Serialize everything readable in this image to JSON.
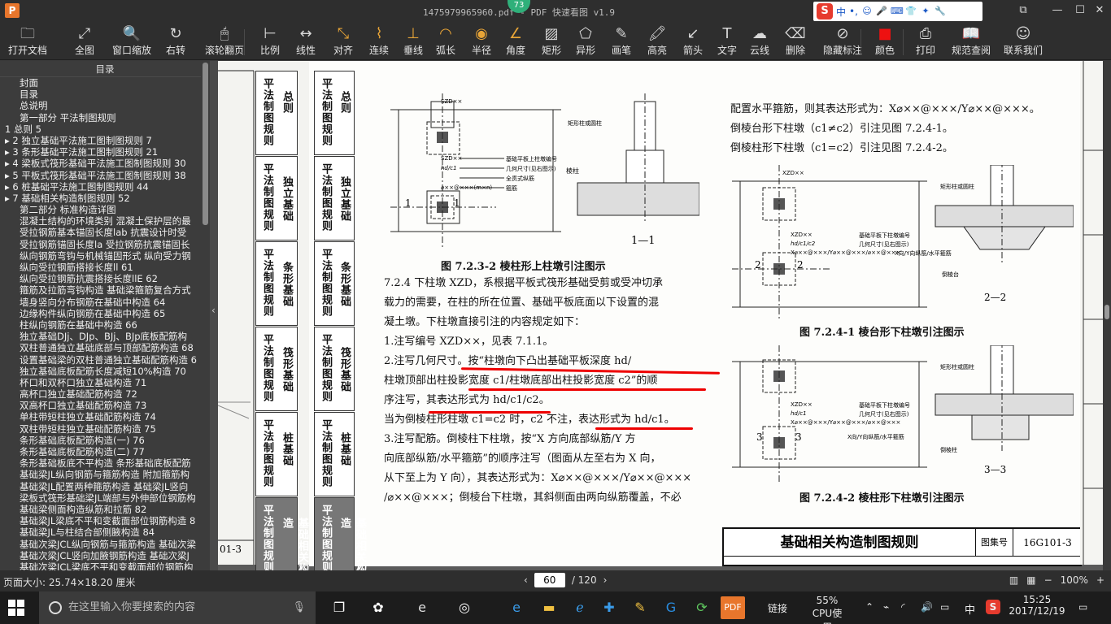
{
  "window": {
    "title": "1475979965960.pdf - PDF 快速看图 v1.9",
    "badge": "73",
    "ime": {
      "mode": "中",
      "punct": "•,"
    }
  },
  "toolbar": {
    "items": [
      {
        "label": "打开文档",
        "icon": "folder-icon"
      },
      {
        "label": "全图",
        "icon": "fit-all-icon"
      },
      {
        "label": "窗口缩放",
        "icon": "magnify-icon"
      },
      {
        "label": "右转",
        "icon": "rotate-right-icon"
      },
      {
        "label": "滚轮翻页",
        "icon": "mouse-icon"
      },
      {
        "label": "比例",
        "icon": "scale-icon"
      },
      {
        "label": "线性",
        "icon": "linear-measure-icon"
      },
      {
        "label": "对齐",
        "icon": "align-measure-icon"
      },
      {
        "label": "连续",
        "icon": "continuous-measure-icon"
      },
      {
        "label": "垂线",
        "icon": "perpendicular-icon"
      },
      {
        "label": "弧长",
        "icon": "arc-length-icon"
      },
      {
        "label": "半径",
        "icon": "radius-icon"
      },
      {
        "label": "角度",
        "icon": "angle-icon"
      },
      {
        "label": "矩形",
        "icon": "rectangle-area-icon"
      },
      {
        "label": "异形",
        "icon": "polygon-area-icon"
      },
      {
        "label": "画笔",
        "icon": "pen-icon"
      },
      {
        "label": "高亮",
        "icon": "highlight-icon"
      },
      {
        "label": "箭头",
        "icon": "arrow-icon"
      },
      {
        "label": "文字",
        "icon": "text-icon"
      },
      {
        "label": "云线",
        "icon": "cloud-line-icon"
      },
      {
        "label": "删除",
        "icon": "eraser-icon"
      },
      {
        "label": "隐藏标注",
        "icon": "hide-markup-icon"
      },
      {
        "label": "颜色",
        "icon": "color-swatch-icon"
      },
      {
        "label": "打印",
        "icon": "printer-icon"
      },
      {
        "label": "规范查阅",
        "icon": "book-icon"
      },
      {
        "label": "联系我们",
        "icon": "contact-icon"
      }
    ]
  },
  "sidebar": {
    "header": "目录",
    "items": [
      "封面",
      "目录",
      "总说明",
      "第一部分  平法制图规则",
      "1 总则  5",
      "▸ 2 独立基础平法施工图制图规则  7",
      "▸ 3 条形基础平法施工图制图规则  21",
      "▸ 4 梁板式筏形基础平法施工图制图规则  30",
      "▸ 5 平板式筏形基础平法施工图制图规则  38",
      "▸ 6 桩基础平法施工图制图规则  44",
      "▸ 7 基础相关构造制图规则  52",
      "第二部分  标准构造详图",
      "混凝土结构的环境类别  混凝土保护层的最",
      "受拉钢筋基本锚固长度lab  抗震设计时受",
      "受拉钢筋锚固长度la  受拉钢筋抗震锚固长",
      "纵向钢筋弯钩与机械锚固形式  纵向受力钢",
      "纵向受拉钢筋搭接长度ll  61",
      "纵向受拉钢筋抗震搭接长度llE  62",
      "箍筋及拉筋弯钩构造  基础梁箍筋复合方式",
      "墙身竖向分布钢筋在基础中构造  64",
      "边缘构件纵向钢筋在基础中构造  65",
      "柱纵向钢筋在基础中构造  66",
      "独立基础DJj、DJp、BJj、BJp底板配筋构",
      "双柱普通独立基础底部与顶部配筋构造  68",
      "设置基础梁的双柱普通独立基础配筋构造  6",
      "独立基础底板配筋长度减短10%构造  70",
      "杯口和双杯口独立基础构造  71",
      "高杯口独立基础配筋构造  72",
      "双高杯口独立基础配筋构造  73",
      "单柱带短柱独立基础配筋构造  74",
      "双柱带短柱独立基础配筋构造  75",
      "条形基础底板配筋构造(一)  76",
      "条形基础底板配筋构造(二)  77",
      "条形基础板底不平构造  条形基础底板配筋",
      "基础梁JL纵向钢筋与箍筋构造  附加箍筋构",
      "基础梁JL配置两种箍筋构造  基础梁JL竖向",
      "梁板式筏形基础梁JL端部与外伸部位钢筋构",
      "基础梁侧面构造纵筋和拉筋  82",
      "基础梁JL梁底不平和变截面部位钢筋构造  8",
      "基础梁JL与柱结合部侧腋构造  84",
      "基础次梁JCL纵向钢筋与箍筋构造  基础次梁",
      "基础次梁JCL竖向加腋钢筋构造  基础次梁J",
      "基础次梁JCL梁底不平和变截面部位钢筋构"
    ]
  },
  "document": {
    "tabs_left": [
      "平法制图规则",
      "总则",
      "平法制图规则",
      "独立基础",
      "平法制图规则",
      "条形基础",
      "平法制图规则",
      "筏形基础",
      "平法制图规则",
      "桩基础",
      "平法制图规则",
      "基础相关构造"
    ],
    "page_code_left": "01-3",
    "tabs_main": [
      "平法制图规则",
      "总则",
      "平法制图规则",
      "独立基础",
      "平法制图规则",
      "条形基础",
      "平法制图规则",
      "筏形基础",
      "平法制图规则",
      "桩基础",
      "平法制图规则",
      "基础相关构造"
    ],
    "fig_7232_caption": "图 7.2.3-2  棱柱形上柱墩引注图示",
    "section_label_11": "1—1",
    "para_724_title": "7.2.4  下柱墩 XZD，",
    "para_724_lines": [
      "7.2.4  下柱墩 XZD，系根据平板式筏形基础受剪或受冲切承",
      "载力的需要，在柱的所在位置、基础平板底面以下设置的混",
      "凝土墩。下柱墩直接引注的内容规定如下：",
      "    1.注写编号 XZD××，见表 7.1.1。",
      "    2.注写几何尺寸。按“柱墩向下凸出基础平板深度  hd/",
      "柱墩顶部出柱投影宽度  c1/柱墩底部出柱投影宽度  c2”的顺",
      "序注写，其表达形式为 hd/c1/c2。",
      "    当为倒棱柱形柱墩 c1=c2 时，c2 不注，表达形式为 hd/c1。",
      "    3.注写配筋。倒棱柱下柱墩，按“X 方向底部纵筋/Y 方",
      "向底部纵筋/水平箍筋”的顺序注写（图面从左至右为 X 向，",
      "从下至上为 Y 向），其表达形式为：X⌀××@×××/Y⌀××@×××",
      "/⌀××@×××；倒棱台下柱墩，其斜侧面由两向纵筋覆盖，不必"
    ],
    "right_text_lines": [
      "配置水平箍筋，则其表达形式为：X⌀××@×××/Y⌀××@×××。",
      "    倒棱台形下柱墩（c1≠c2）引注见图 7.2.4-1。",
      "    倒棱柱形下柱墩（c1=c2）引注见图 7.2.4-2。"
    ],
    "fig_7241_caption": "图 7.2.4-1  棱台形下柱墩引注图示",
    "fig_7242_caption": "图 7.2.4-2  棱柱形下柱墩引注图示",
    "section_label_22": "2—2",
    "section_label_33": "3—3",
    "stamp_title": "基础相关构造制图规则",
    "stamp_atlas_label": "图集号",
    "stamp_atlas_no": "16G101-3",
    "drawing_labels": {
      "xzd": "XZD××",
      "szd": "SZD××",
      "hd_c1": "hd/c1",
      "hd_c1_c2": "hd/c1/c2",
      "rebar1": "X⌀××@×××/Y⌀××@×××/⌀××@×××",
      "rebar2": "⌀××@×××(m×n)",
      "note1": "基础平板上柱墩编号",
      "note2": "几何尺寸(见右图示)",
      "note3": "全贯式纵筋",
      "note4": "箍筋",
      "note5": "基础平板下柱墩编号",
      "note6": "X向/Y向纵筋/水平箍筋",
      "col_outline": "矩形柱或圆柱",
      "column": "棱柱",
      "inv_frustum": "倒棱台",
      "inv_prism": "倒棱柱",
      "num1": "1",
      "num2": "2",
      "num3": "3"
    }
  },
  "statusbar": {
    "page_size": "页面大小: 25.74×18.20 厘米",
    "current_page": "60",
    "total_pages": "/ 120",
    "zoom": "100%"
  },
  "taskbar": {
    "search_placeholder": "在这里输入你要搜索的内容",
    "tray_link": "链接",
    "cpu_value": "55%",
    "cpu_label": "CPU使用",
    "time": "15:25",
    "date": "2017/12/19",
    "lang": "中"
  },
  "colors": {
    "titlebar": "#2e2e2e",
    "accent_orange": "#e8762c",
    "red_markup": "#e00000",
    "taskbar": "#1c1c1c"
  }
}
